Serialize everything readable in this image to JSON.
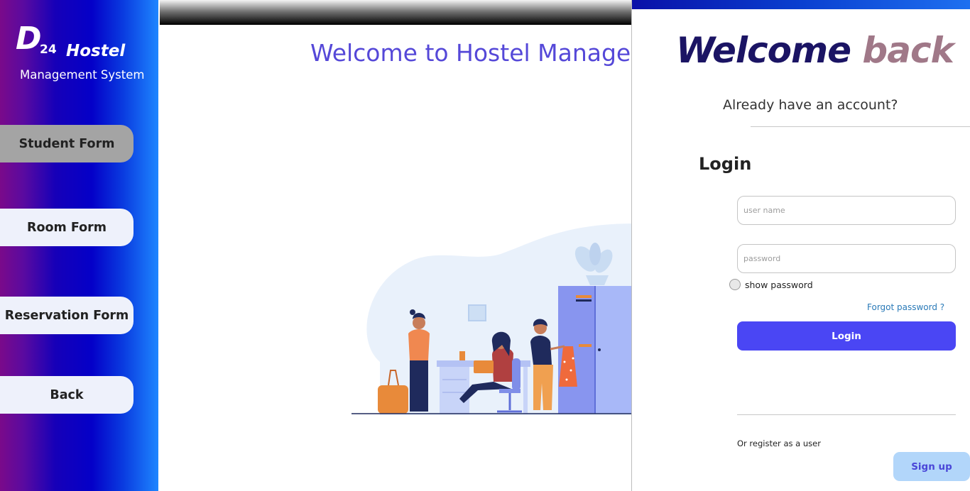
{
  "sidebar": {
    "logo": {
      "letter": "D",
      "number": "24",
      "name": "Hostel",
      "subtitle": "Management System"
    },
    "nav": [
      "Student Form",
      "Room Form",
      "Reservation  Form",
      "Back"
    ]
  },
  "main": {
    "welcome_title": "Welcome to  Hostel Manage"
  },
  "login_panel": {
    "heading_part1": "Welcome ",
    "heading_part2": "back",
    "already": "Already have an account?",
    "login_heading": "Login",
    "username_placeholder": "user name",
    "password_placeholder": "password",
    "show_password": "show password",
    "forgot": "Forgot password ?",
    "login_button": "Login",
    "register_text": "Or register as a user",
    "signup_button": "Sign up"
  },
  "colors": {
    "accent": "#4a46f4",
    "title_blue": "#5548d8",
    "signup_bg": "#b2d6fa"
  }
}
